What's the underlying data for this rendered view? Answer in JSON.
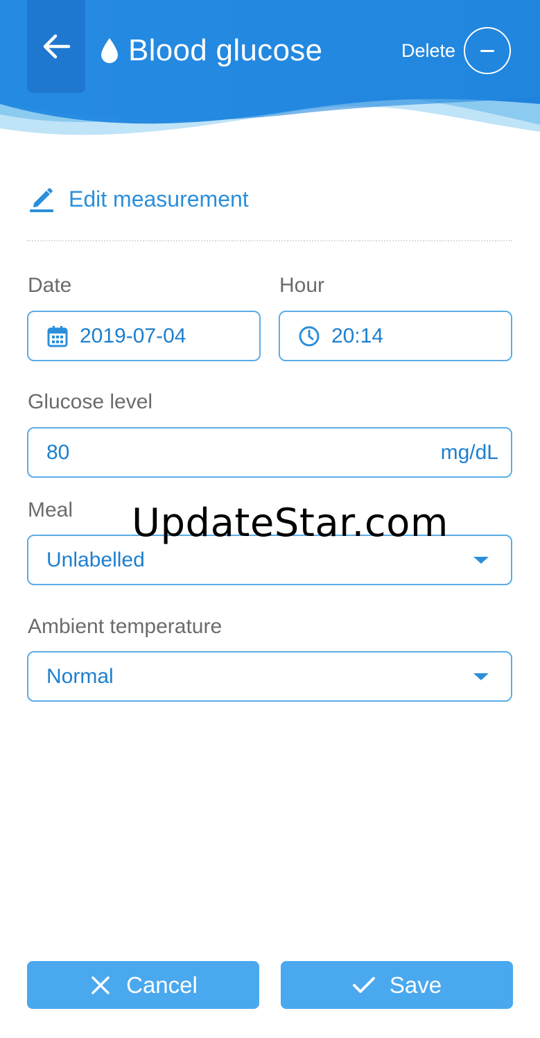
{
  "colors": {
    "header_blue": "#2389e0",
    "accent": "#2b8fdb",
    "field_border": "#5aace6",
    "button": "#4aa8ee"
  },
  "header": {
    "title": "Blood glucose",
    "title_icon": "drop-icon",
    "back_icon": "arrow-left-icon",
    "delete_label": "Delete",
    "delete_icon": "minus-circle-icon"
  },
  "section": {
    "icon": "pencil-icon",
    "title": "Edit measurement"
  },
  "form": {
    "date": {
      "label": "Date",
      "value": "2019-07-04",
      "icon": "calendar-icon"
    },
    "hour": {
      "label": "Hour",
      "value": "20:14",
      "icon": "clock-icon"
    },
    "glucose": {
      "label": "Glucose level",
      "value": "80",
      "unit": "mg/dL"
    },
    "meal": {
      "label": "Meal",
      "selected": "Unlabelled"
    },
    "ambient": {
      "label": "Ambient temperature",
      "selected": "Normal"
    }
  },
  "watermark": "UpdateStar.com",
  "buttons": {
    "cancel": {
      "label": "Cancel",
      "icon": "close-icon"
    },
    "save": {
      "label": "Save",
      "icon": "check-icon"
    }
  }
}
